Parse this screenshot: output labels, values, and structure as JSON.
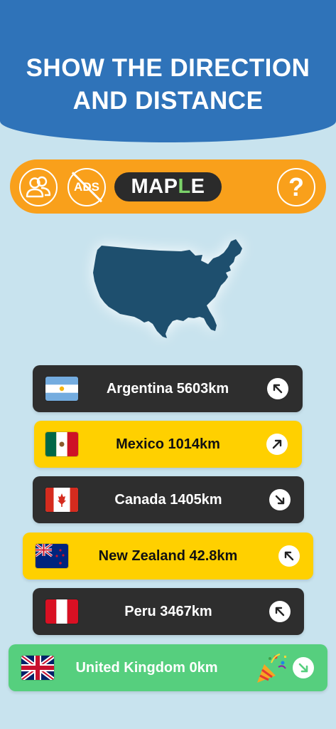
{
  "header": {
    "line1": "SHOW THE DIRECTION",
    "line2": "AND DISTANCE"
  },
  "toolbar": {
    "friends_icon": "friends-icon",
    "no_ads_label": "ADS",
    "logo_prefix": "MAP",
    "logo_accent": "L",
    "logo_suffix": "E",
    "help_label": "?"
  },
  "map": {
    "icon": "usa-map-silhouette"
  },
  "guesses": [
    {
      "text": "Argentina 5603km",
      "flag": "argentina-flag",
      "arrow": "north-west-arrow"
    },
    {
      "text": "Mexico 1014km",
      "flag": "mexico-flag",
      "arrow": "north-east-arrow"
    },
    {
      "text": "Canada 1405km",
      "flag": "canada-flag",
      "arrow": "south-east-arrow"
    },
    {
      "text": "New Zealand 42.8km",
      "flag": "new-zealand-flag",
      "arrow": "north-west-arrow"
    },
    {
      "text": "Peru 3467km",
      "flag": "peru-flag",
      "arrow": "north-west-arrow"
    },
    {
      "text": "United Kingdom  0km",
      "flag": "uk-flag",
      "arrow": "south-east-arrow",
      "celebration": "party-popper-icon"
    }
  ],
  "colors": {
    "background": "#c8e3ee",
    "header": "#2f73b9",
    "toolbar": "#f9a01b",
    "row_dark": "#2e2e2e",
    "row_yellow": "#ffd000",
    "row_correct": "#56cf7e",
    "map": "#1e4f6e"
  }
}
